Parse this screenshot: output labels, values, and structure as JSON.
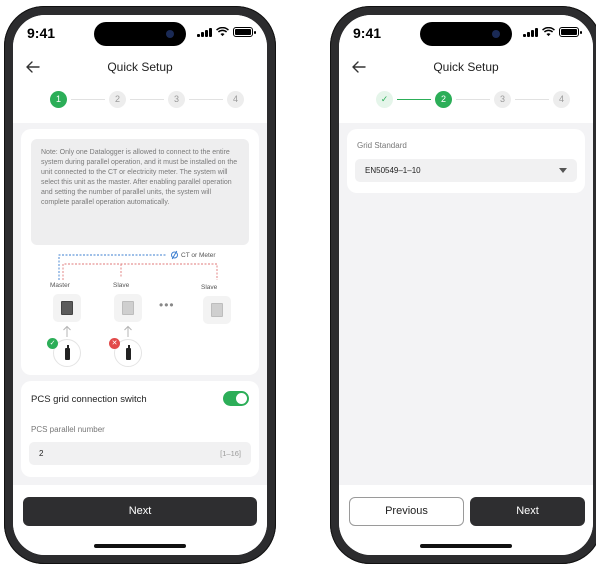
{
  "status_bar": {
    "time": "9:41"
  },
  "nav": {
    "title": "Quick Setup"
  },
  "steps": [
    "1",
    "2",
    "3",
    "4"
  ],
  "left": {
    "note": "Note: Only one Datalogger is allowed to connect to the entire system during parallel operation, and it must be installed on the unit connected to the CT or electricity meter. The system will select this unit as the master. After enabling parallel operation and setting the number of parallel units, the system will complete parallel operation automatically.",
    "diagram": {
      "ct_label": "CT or Meter",
      "master_label": "Master",
      "slave_label_1": "Slave",
      "slave_label_2": "Slave",
      "dots": "•••"
    },
    "switch_label": "PCS grid connection switch",
    "switch_on": true,
    "parallel_label": "PCS parallel number",
    "parallel_value": "2",
    "parallel_range": "[1–16]",
    "next_label": "Next"
  },
  "right": {
    "grid_label": "Grid Standard",
    "grid_value": "EN50549–1–10",
    "previous_label": "Previous",
    "next_label": "Next"
  },
  "colors": {
    "accent": "#2cae58",
    "error": "#e24b4b",
    "button": "#2e2e30"
  }
}
